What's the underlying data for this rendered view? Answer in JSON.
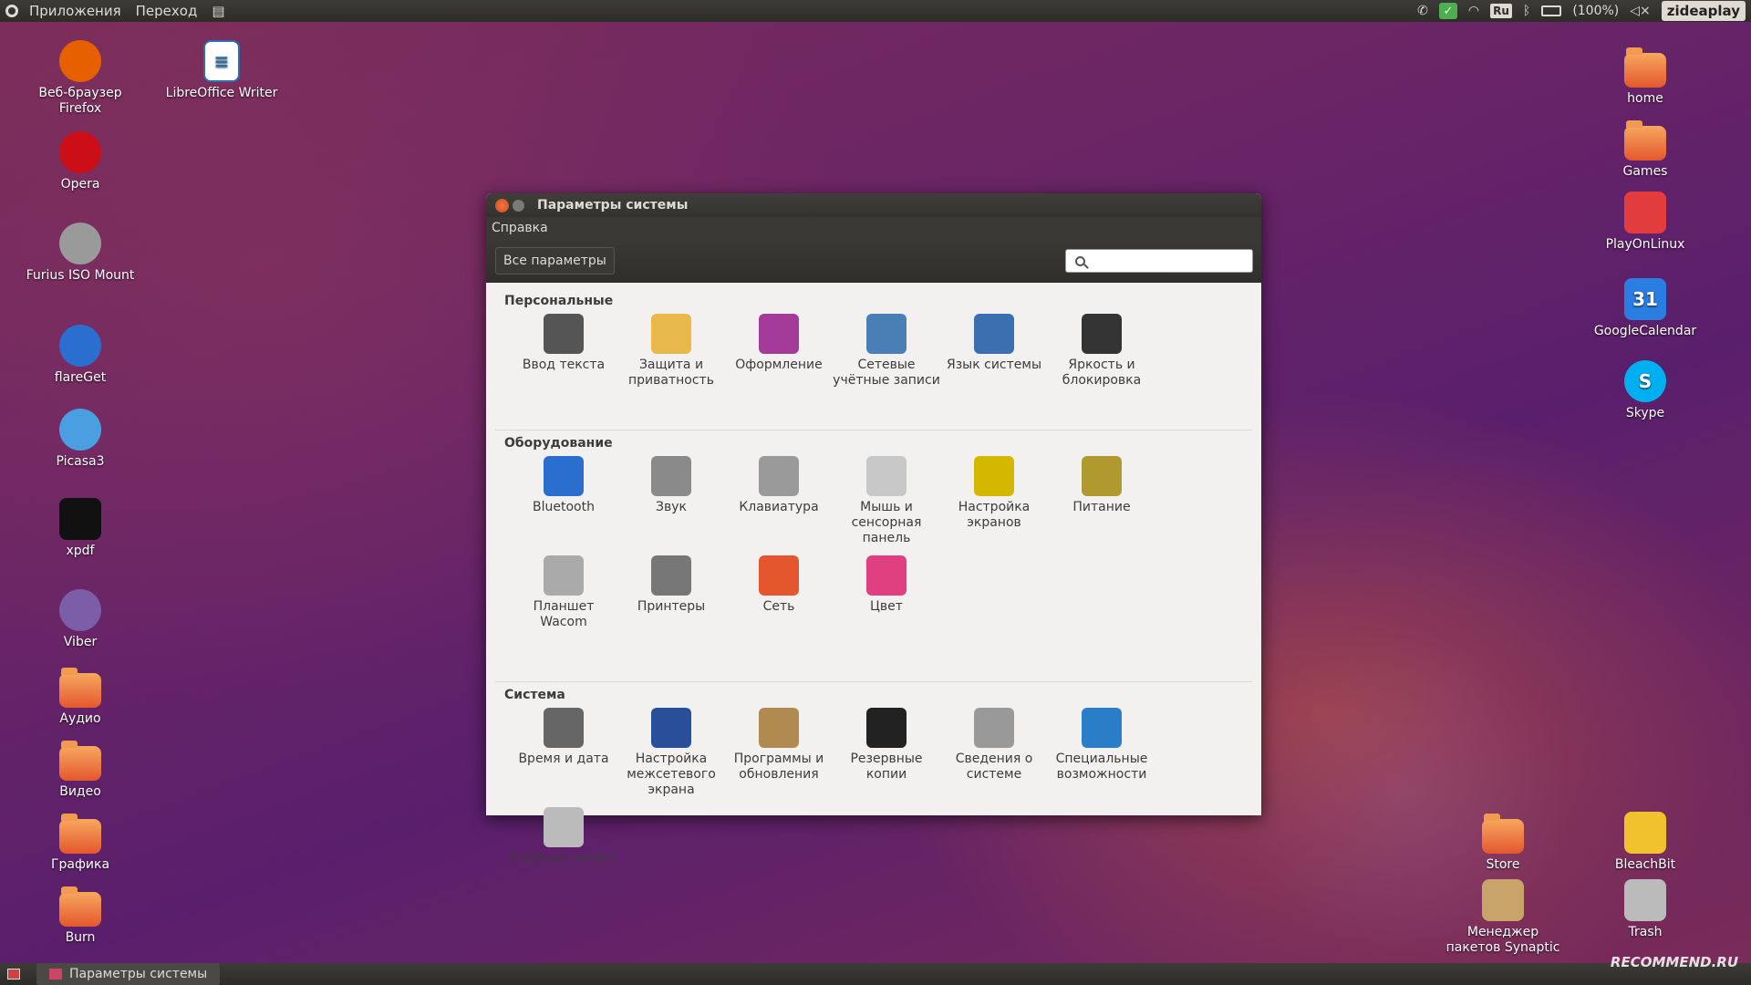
{
  "top_panel": {
    "menus": [
      "Приложения",
      "Переход"
    ],
    "tray": {
      "lang": "Ru",
      "battery": "(100%)",
      "brand": "zideaplay"
    }
  },
  "desktop_left": [
    {
      "label": "Веб-браузер Firefox",
      "icon": "firefox-icon",
      "color": "#e66000"
    },
    {
      "label": "Opera",
      "icon": "opera-icon",
      "color": "#cc0f16"
    },
    {
      "label": "Furius ISO Mount",
      "icon": "disc-icon",
      "color": "#9a9a9a"
    },
    {
      "label": "flareGet",
      "icon": "flareget-icon",
      "color": "#2a6fcf"
    },
    {
      "label": "Picasa3",
      "icon": "picasa-icon",
      "color": "#4a9fe0"
    },
    {
      "label": "xpdf",
      "icon": "xpdf-icon",
      "color": "#111111"
    },
    {
      "label": "Viber",
      "icon": "viber-icon",
      "color": "#7b5ea7"
    },
    {
      "label": "Аудио",
      "icon": "folder-icon",
      "color": "#e4572e"
    },
    {
      "label": "Видео",
      "icon": "folder-icon",
      "color": "#e4572e"
    },
    {
      "label": "Графика",
      "icon": "folder-icon",
      "color": "#e4572e"
    },
    {
      "label": "Burn",
      "icon": "folder-icon",
      "color": "#e4572e"
    }
  ],
  "desktop_writer": {
    "label": "LibreOffice Writer",
    "icon": "writer-icon",
    "color": "#2a6fb0"
  },
  "desktop_right": [
    {
      "label": "home",
      "icon": "home-folder-icon",
      "color": "#e4572e"
    },
    {
      "label": "Games",
      "icon": "folder-icon",
      "color": "#e4572e"
    },
    {
      "label": "PlayOnLinux",
      "icon": "playonlinux-icon",
      "color": "#e23c3c"
    },
    {
      "label": "GoogleCalendar",
      "icon": "calendar-icon",
      "color": "#2a7de1",
      "glyph": "31"
    },
    {
      "label": "Skype",
      "icon": "skype-icon",
      "color": "#00aff0",
      "glyph": "S"
    }
  ],
  "desktop_bottom_right": [
    {
      "label": "Store",
      "icon": "folder-icon",
      "color": "#e4572e"
    },
    {
      "label": "BleachBit",
      "icon": "bleachbit-icon",
      "color": "#f2c12e"
    },
    {
      "label": "Менеджер пакетов Synaptic",
      "icon": "synaptic-icon",
      "color": "#c9a46a"
    },
    {
      "label": "Trash",
      "icon": "trash-icon",
      "color": "#bbbbbb"
    }
  ],
  "window": {
    "title": "Параметры системы",
    "menu": "Справка",
    "all_settings": "Все параметры",
    "search_placeholder": "",
    "sections": [
      {
        "title": "Персональные",
        "items": [
          {
            "label": "Ввод текста",
            "icon": "text-entry-icon",
            "color": "#555555"
          },
          {
            "label": "Защита и приватность",
            "icon": "privacy-icon",
            "color": "#e8b84a"
          },
          {
            "label": "Оформление",
            "icon": "appearance-icon",
            "color": "#a43b9b"
          },
          {
            "label": "Сетевые учётные записи",
            "icon": "online-accounts-icon",
            "color": "#4a7fb5"
          },
          {
            "label": "Язык системы",
            "icon": "language-icon",
            "color": "#3c6fb0"
          },
          {
            "label": "Яркость и блокировка",
            "icon": "lock-screen-icon",
            "color": "#333333"
          }
        ]
      },
      {
        "title": "Оборудование",
        "items": [
          {
            "label": "Bluetooth",
            "icon": "bluetooth-icon",
            "color": "#2a6fcf"
          },
          {
            "label": "Звук",
            "icon": "sound-icon",
            "color": "#8a8a8a"
          },
          {
            "label": "Клавиатура",
            "icon": "keyboard-icon",
            "color": "#9a9a9a"
          },
          {
            "label": "Мышь и сенсорная панель",
            "icon": "mouse-icon",
            "color": "#c8c8c8"
          },
          {
            "label": "Настройка экранов",
            "icon": "displays-icon",
            "color": "#d4b800"
          },
          {
            "label": "Питание",
            "icon": "power-icon",
            "color": "#b09a30"
          },
          {
            "label": "Планшет Wacom",
            "icon": "wacom-icon",
            "color": "#aaaaaa"
          },
          {
            "label": "Принтеры",
            "icon": "printer-icon",
            "color": "#777777"
          },
          {
            "label": "Сеть",
            "icon": "network-icon",
            "color": "#e4572e"
          },
          {
            "label": "Цвет",
            "icon": "color-icon",
            "color": "#e04080"
          }
        ]
      },
      {
        "title": "Система",
        "items": [
          {
            "label": "Время и дата",
            "icon": "clock-icon",
            "color": "#666666"
          },
          {
            "label": "Настройка межсетевого экрана",
            "icon": "firewall-icon",
            "color": "#2a4f9a"
          },
          {
            "label": "Программы и обновления",
            "icon": "software-icon",
            "color": "#b08a50"
          },
          {
            "label": "Резервные копии",
            "icon": "backup-icon",
            "color": "#222222"
          },
          {
            "label": "Сведения о системе",
            "icon": "system-info-icon",
            "color": "#999999"
          },
          {
            "label": "Специальные возможности",
            "icon": "accessibility-icon",
            "color": "#2a7ec8"
          },
          {
            "label": "Учётные записи",
            "icon": "user-accounts-icon",
            "color": "#bbbbbb"
          }
        ]
      }
    ]
  },
  "taskbar": {
    "task_label": "Параметры системы",
    "watermark": "RECOMMEND.RU"
  }
}
